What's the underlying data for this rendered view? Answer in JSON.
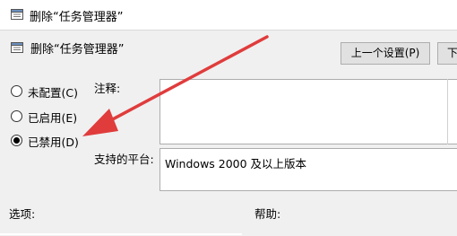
{
  "window": {
    "title": "删除“任务管理器”"
  },
  "header": {
    "title": "删除“任务管理器”"
  },
  "toolbar": {
    "prev_label": "上一个设置(P)",
    "next_label": "下"
  },
  "radios": [
    {
      "label": "未配置(C)",
      "selected": false
    },
    {
      "label": "已启用(E)",
      "selected": false
    },
    {
      "label": "已禁用(D)",
      "selected": true
    }
  ],
  "fields": {
    "comment_label": "注释:",
    "comment_value": "",
    "platform_label": "支持的平台:",
    "platform_value": "Windows 2000 及以上版本"
  },
  "bottom": {
    "options_label": "选项:",
    "help_label": "帮助:"
  },
  "annotation": {
    "arrow_color": "#e03c3c",
    "icons": [
      "policy-icon",
      "policy-icon",
      "red-arrow-annotation"
    ]
  }
}
